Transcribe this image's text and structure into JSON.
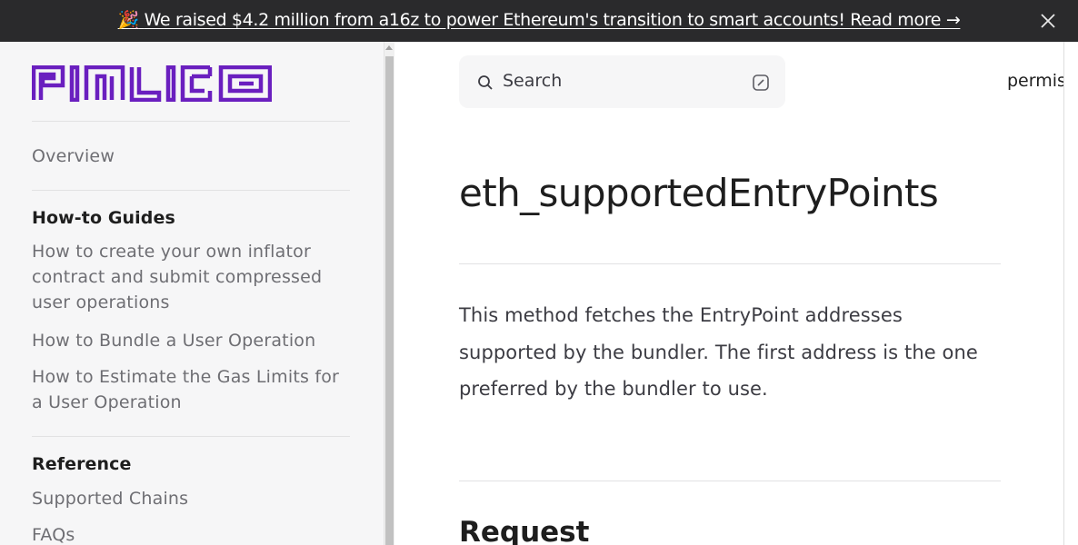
{
  "banner": {
    "emoji": "🎉",
    "text": "We raised $4.2 million from a16z to power Ethereum's transition to smart accounts! Read more →"
  },
  "sidebar": {
    "logo_text": "PIMLICO",
    "overview": "Overview",
    "sections": [
      {
        "heading": "How-to Guides",
        "items": [
          "How to create your own inflator contract and submit compressed user operations",
          "How to Bundle a User Operation",
          "How to Estimate the Gas Limits for a User Operation"
        ]
      },
      {
        "heading": "Reference",
        "items": [
          "Supported Chains",
          "FAQs"
        ]
      }
    ]
  },
  "search": {
    "label": "Search"
  },
  "nav": {
    "partial_item": "permis"
  },
  "content": {
    "title": "eth_supportedEntryPoints",
    "description": "This method fetches the EntryPoint addresses supported by the bundler. The first address is the one preferred by the bundler to use.",
    "section_heading": "Request"
  },
  "colors": {
    "brand_purple": "#6a1fbf",
    "banner_bg": "#2a2a2c"
  }
}
